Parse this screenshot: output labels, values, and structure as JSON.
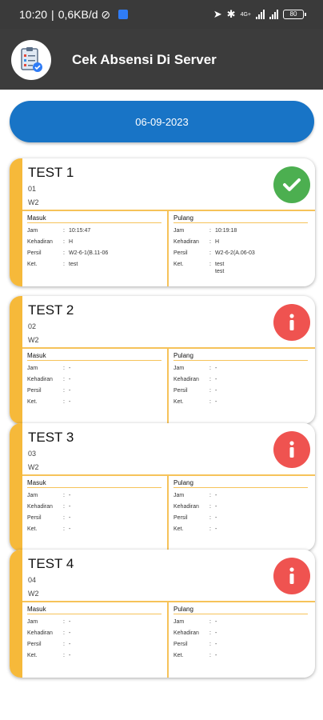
{
  "status_bar": {
    "time": "10:20",
    "speed": "0,6KB/d",
    "network": "4G+",
    "battery": "80"
  },
  "app_bar": {
    "title": "Cek Absensi Di Server",
    "logo_icon": "clipboard-check-icon"
  },
  "date_button": {
    "label": "06-09-2023"
  },
  "colors": {
    "accent_stripe": "#f6b93a",
    "date_button": "#1874c6",
    "ok": "#4caf50",
    "info": "#ef5350",
    "app_bar": "#3c3c3c"
  },
  "cards": [
    {
      "name": "TEST 1",
      "code": "01",
      "group": "W2",
      "status_icon": "check-icon",
      "masuk": {
        "title": "Masuk",
        "rows": [
          {
            "label": "Jam",
            "colon": ":",
            "value": "10:15:47"
          },
          {
            "label": "Kehadiran",
            "colon": ":",
            "value": "H"
          },
          {
            "label": "Persil",
            "colon": ":",
            "value": "W2-6-1(B.11-06"
          },
          {
            "label": "Ket.",
            "colon": ":",
            "value": "test"
          }
        ]
      },
      "pulang": {
        "title": "Pulang",
        "rows": [
          {
            "label": "Jam",
            "colon": ":",
            "value": "10:19:18"
          },
          {
            "label": "Kehadiran",
            "colon": ":",
            "value": "H"
          },
          {
            "label": "Persil",
            "colon": ":",
            "value": "W2-6-2(A.06-03"
          },
          {
            "label": "Ket.",
            "colon": ":",
            "value": "test\ntest"
          }
        ]
      }
    },
    {
      "name": "TEST 2",
      "code": "02",
      "group": "W2",
      "status_icon": "info-icon",
      "masuk": {
        "title": "Masuk",
        "rows": [
          {
            "label": "Jam",
            "colon": ":",
            "value": "-"
          },
          {
            "label": "Kehadiran",
            "colon": ":",
            "value": "-"
          },
          {
            "label": "Persil",
            "colon": ":",
            "value": "-"
          },
          {
            "label": "Ket.",
            "colon": ":",
            "value": "-"
          }
        ]
      },
      "pulang": {
        "title": "Pulang",
        "rows": [
          {
            "label": "Jam",
            "colon": ":",
            "value": "-"
          },
          {
            "label": "Kehadiran",
            "colon": ":",
            "value": "-"
          },
          {
            "label": "Persil",
            "colon": ":",
            "value": "-"
          },
          {
            "label": "Ket.",
            "colon": ":",
            "value": "-"
          }
        ]
      }
    },
    {
      "name": "TEST 3",
      "code": "03",
      "group": "W2",
      "status_icon": "info-icon",
      "masuk": {
        "title": "Masuk",
        "rows": [
          {
            "label": "Jam",
            "colon": ":",
            "value": "-"
          },
          {
            "label": "Kehadiran",
            "colon": ":",
            "value": "-"
          },
          {
            "label": "Persil",
            "colon": ":",
            "value": "-"
          },
          {
            "label": "Ket.",
            "colon": ":",
            "value": "-"
          }
        ]
      },
      "pulang": {
        "title": "Pulang",
        "rows": [
          {
            "label": "Jam",
            "colon": ":",
            "value": "-"
          },
          {
            "label": "Kehadiran",
            "colon": ":",
            "value": "-"
          },
          {
            "label": "Persil",
            "colon": ":",
            "value": "-"
          },
          {
            "label": "Ket.",
            "colon": ":",
            "value": "-"
          }
        ]
      }
    },
    {
      "name": "TEST 4",
      "code": "04",
      "group": "W2",
      "status_icon": "info-icon",
      "masuk": {
        "title": "Masuk",
        "rows": [
          {
            "label": "Jam",
            "colon": ":",
            "value": "-"
          },
          {
            "label": "Kehadiran",
            "colon": ":",
            "value": "-"
          },
          {
            "label": "Persil",
            "colon": ":",
            "value": "-"
          },
          {
            "label": "Ket.",
            "colon": ":",
            "value": "-"
          }
        ]
      },
      "pulang": {
        "title": "Pulang",
        "rows": [
          {
            "label": "Jam",
            "colon": ":",
            "value": "-"
          },
          {
            "label": "Kehadiran",
            "colon": ":",
            "value": "-"
          },
          {
            "label": "Persil",
            "colon": ":",
            "value": "-"
          },
          {
            "label": "Ket.",
            "colon": ":",
            "value": "-"
          }
        ]
      }
    }
  ]
}
